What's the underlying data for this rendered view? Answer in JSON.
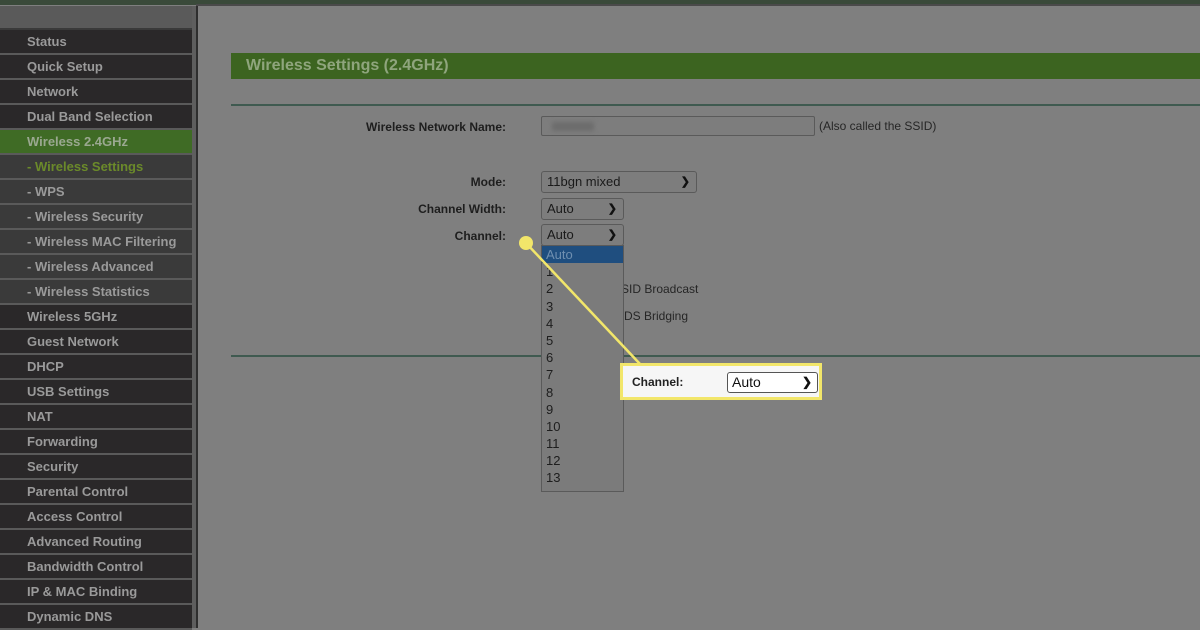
{
  "sidebar": {
    "items": [
      {
        "label": "Status",
        "type": "main"
      },
      {
        "label": "Quick Setup",
        "type": "main"
      },
      {
        "label": "Network",
        "type": "main"
      },
      {
        "label": "Dual Band Selection",
        "type": "main"
      },
      {
        "label": "Wireless 2.4GHz",
        "type": "main",
        "active": true
      },
      {
        "label": "- Wireless Settings",
        "type": "sub",
        "current": true
      },
      {
        "label": "- WPS",
        "type": "sub"
      },
      {
        "label": "- Wireless Security",
        "type": "sub"
      },
      {
        "label": "- Wireless MAC Filtering",
        "type": "sub"
      },
      {
        "label": "- Wireless Advanced",
        "type": "sub"
      },
      {
        "label": "- Wireless Statistics",
        "type": "sub"
      },
      {
        "label": "Wireless 5GHz",
        "type": "main"
      },
      {
        "label": "Guest Network",
        "type": "main"
      },
      {
        "label": "DHCP",
        "type": "main"
      },
      {
        "label": "USB Settings",
        "type": "main"
      },
      {
        "label": "NAT",
        "type": "main"
      },
      {
        "label": "Forwarding",
        "type": "main"
      },
      {
        "label": "Security",
        "type": "main"
      },
      {
        "label": "Parental Control",
        "type": "main"
      },
      {
        "label": "Access Control",
        "type": "main"
      },
      {
        "label": "Advanced Routing",
        "type": "main"
      },
      {
        "label": "Bandwidth Control",
        "type": "main"
      },
      {
        "label": "IP & MAC Binding",
        "type": "main"
      },
      {
        "label": "Dynamic DNS",
        "type": "main"
      }
    ]
  },
  "main": {
    "title": "Wireless Settings (2.4GHz)",
    "network_name": {
      "label": "Wireless Network Name:",
      "value": "",
      "note": "(Also called the SSID)"
    },
    "mode": {
      "label": "Mode:",
      "value": "11bgn mixed"
    },
    "channel_width": {
      "label": "Channel Width:",
      "value": "Auto"
    },
    "channel": {
      "label": "Channel:",
      "value": "Auto",
      "options": [
        "Auto",
        "1",
        "2",
        "3",
        "4",
        "5",
        "6",
        "7",
        "8",
        "9",
        "10",
        "11",
        "12",
        "13"
      ],
      "highlighted": "Auto"
    },
    "ssid_broadcast_partial": "SID Broadcast",
    "wds_bridging_partial": "DS Bridging"
  },
  "callout": {
    "label": "Channel:",
    "value": "Auto"
  },
  "colors": {
    "accent_green": "#3c6420",
    "highlight_yellow": "#f2e66a",
    "selected_option": "#1f4e7f"
  }
}
